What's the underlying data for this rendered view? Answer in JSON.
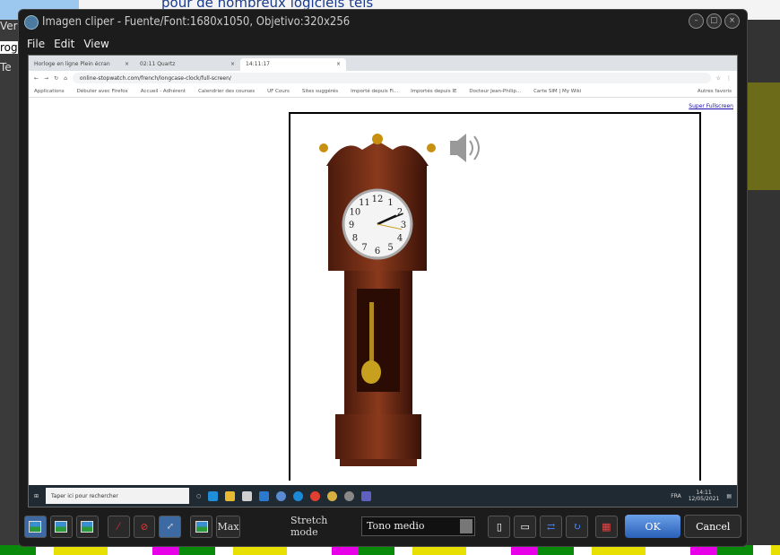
{
  "window": {
    "title": "Imagen cliper - Fuente/Font:1680x1050,  Objetivo:320x256",
    "menu": [
      "File",
      "Edit",
      "View"
    ]
  },
  "background": {
    "top_text": "pour de nombreux logiciels tels",
    "left_texts": [
      "Ver",
      "rog",
      "Te"
    ]
  },
  "browser": {
    "tabs": [
      "Horloge en ligne Plein écran",
      "02:11 Quartz",
      "14:11:17"
    ],
    "url": "online-stopwatch.com/french/longcase-clock/full-screen/",
    "bookmarks": [
      "Applications",
      "Débuter avec Firefox",
      "Accueil - Adhérent",
      "Calendrier des courses",
      "UF Cours",
      "Sites suggérés",
      "Importé depuis Fi...",
      "Importés depuis IE",
      "Docteur Jean-Philip...",
      "Carte SIM | My Wiki",
      "Autres favoris"
    ],
    "super_fullscreen": "Super Fullscreen",
    "taskbar": {
      "search": "Taper ici pour rechercher",
      "lang": "FRA",
      "time": "14:11",
      "date": "12/05/2021"
    }
  },
  "clock": {
    "hour": 2,
    "minute": 11,
    "second": 17
  },
  "toolbar": {
    "max_label": "Max",
    "stretch_label": "Stretch mode",
    "stretch_value": "Tono medio",
    "ok": "OK",
    "cancel": "Cancel"
  }
}
